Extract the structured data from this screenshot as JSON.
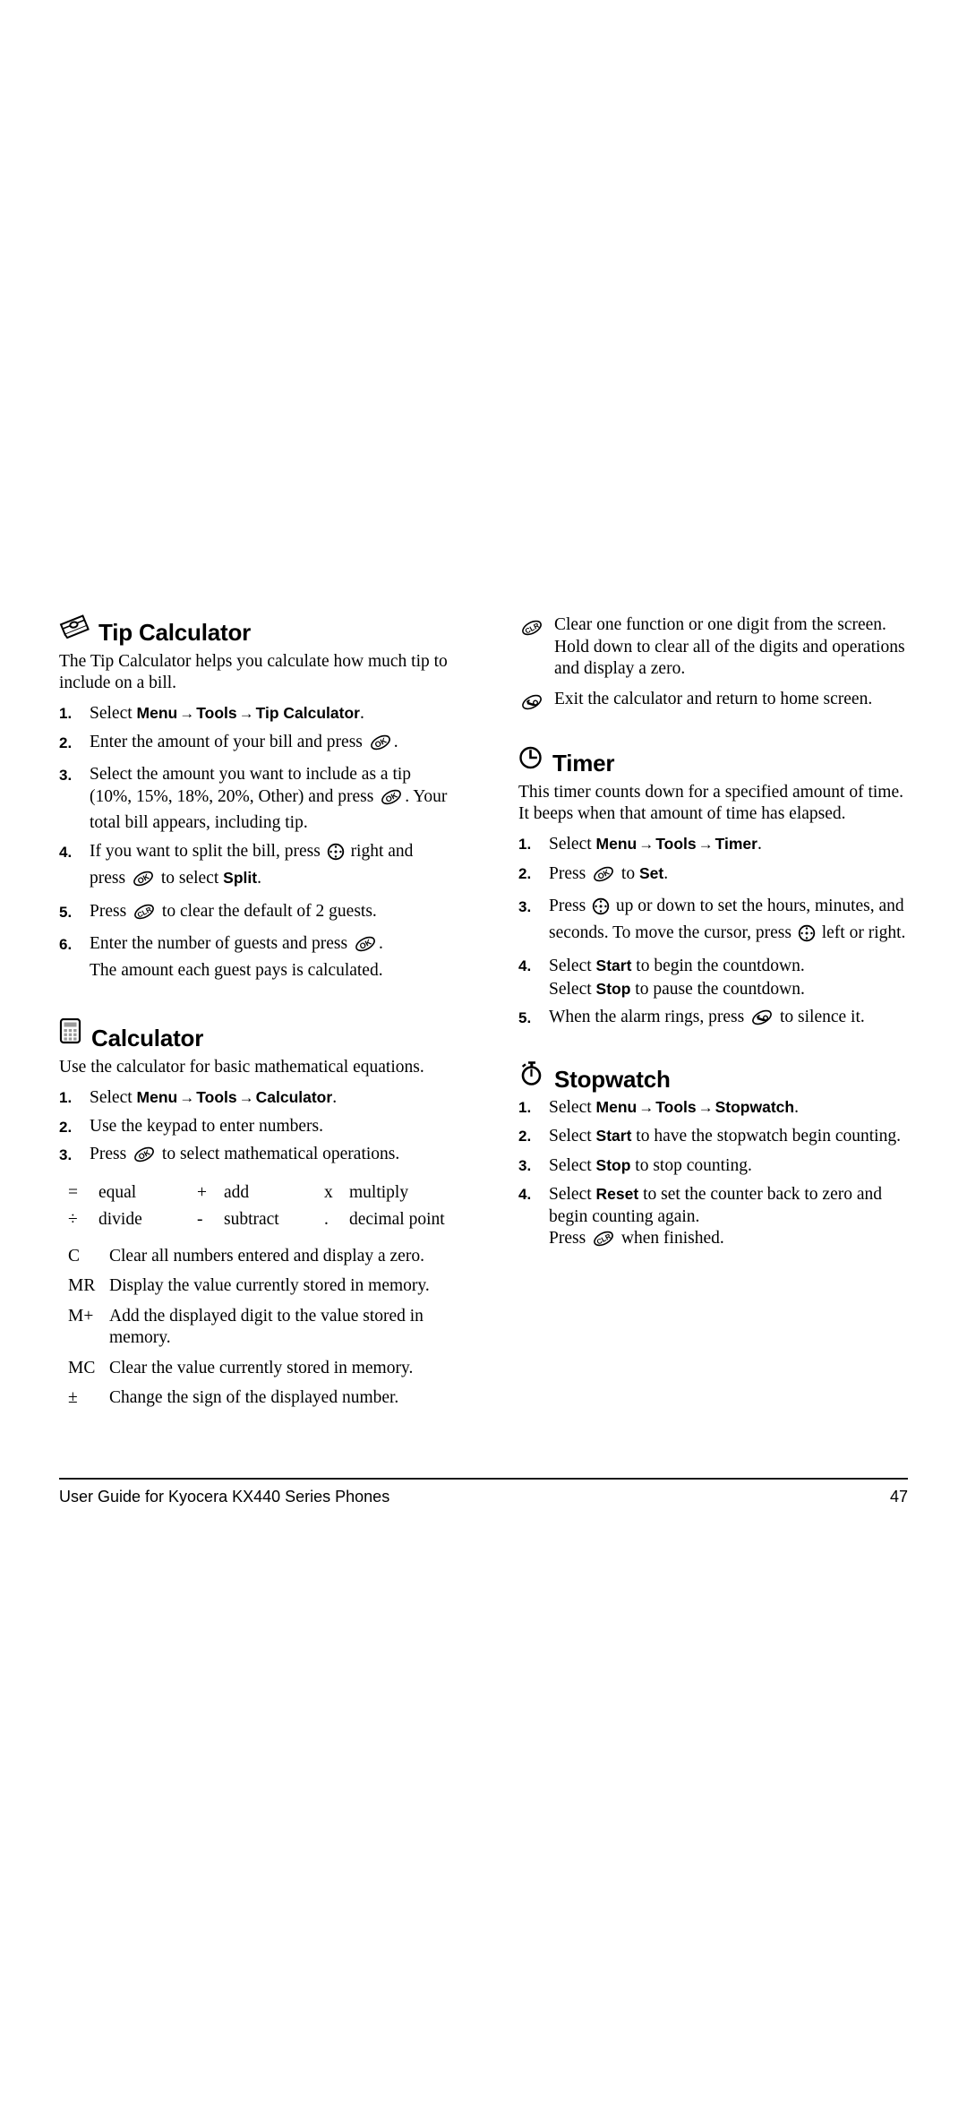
{
  "page": {
    "number": "47",
    "footer_title": "User Guide for Kyocera KX440 Series Phones"
  },
  "icons": {
    "tip_calculator": "money-bills-icon",
    "calculator": "calculator-icon",
    "timer": "clock-icon",
    "stopwatch": "stopwatch-icon",
    "ok_key": "ok-key-icon",
    "clr_key": "clr-key-icon",
    "end_key": "end-call-key-icon",
    "nav_key": "navigation-key-icon"
  },
  "left_column": {
    "tip_calculator": {
      "title": "Tip Calculator",
      "intro": "The Tip Calculator helps you calculate how much tip to include on a bill.",
      "steps": [
        {
          "num": "1.",
          "parts": [
            {
              "t": "text",
              "v": "Select "
            },
            {
              "t": "ui",
              "v": "Menu"
            },
            {
              "t": "arrow",
              "v": "→"
            },
            {
              "t": "ui",
              "v": "Tools"
            },
            {
              "t": "arrow",
              "v": "→"
            },
            {
              "t": "ui",
              "v": "Tip Calculator"
            },
            {
              "t": "text",
              "v": "."
            }
          ]
        },
        {
          "num": "2.",
          "parts": [
            {
              "t": "text",
              "v": "Enter the amount of your bill and press "
            },
            {
              "t": "icon",
              "v": "ok_key"
            },
            {
              "t": "text",
              "v": "."
            }
          ]
        },
        {
          "num": "3.",
          "parts": [
            {
              "t": "text",
              "v": "Select the amount you want to include as a tip (10%, 15%, 18%, 20%, Other) and press "
            },
            {
              "t": "icon",
              "v": "ok_key"
            },
            {
              "t": "text",
              "v": ". Your total bill appears, including tip."
            }
          ]
        },
        {
          "num": "4.",
          "parts": [
            {
              "t": "text",
              "v": "If you want to split the bill, press "
            },
            {
              "t": "icon",
              "v": "nav_key"
            },
            {
              "t": "text",
              "v": " right and press "
            },
            {
              "t": "icon",
              "v": "ok_key"
            },
            {
              "t": "text",
              "v": " to select "
            },
            {
              "t": "ui",
              "v": "Split"
            },
            {
              "t": "text",
              "v": "."
            }
          ]
        },
        {
          "num": "5.",
          "parts": [
            {
              "t": "text",
              "v": "Press "
            },
            {
              "t": "icon",
              "v": "clr_key"
            },
            {
              "t": "text",
              "v": " to clear the default of 2 guests."
            }
          ]
        },
        {
          "num": "6.",
          "parts": [
            {
              "t": "text",
              "v": "Enter the number of guests and press "
            },
            {
              "t": "icon",
              "v": "ok_key"
            },
            {
              "t": "text",
              "v": "."
            }
          ],
          "extra": "The amount each guest pays is calculated."
        }
      ]
    },
    "calculator": {
      "title": "Calculator",
      "intro": "Use the calculator for basic mathematical equations.",
      "steps": [
        {
          "num": "1.",
          "parts": [
            {
              "t": "text",
              "v": "Select "
            },
            {
              "t": "ui",
              "v": "Menu"
            },
            {
              "t": "arrow",
              "v": "→"
            },
            {
              "t": "ui",
              "v": "Tools"
            },
            {
              "t": "arrow",
              "v": "→"
            },
            {
              "t": "ui",
              "v": "Calculator"
            },
            {
              "t": "text",
              "v": "."
            }
          ]
        },
        {
          "num": "2.",
          "parts": [
            {
              "t": "text",
              "v": "Use the keypad to enter numbers."
            }
          ]
        },
        {
          "num": "3.",
          "parts": [
            {
              "t": "text",
              "v": "Press "
            },
            {
              "t": "icon",
              "v": "ok_key"
            },
            {
              "t": "text",
              "v": " to select mathematical operations."
            }
          ]
        }
      ],
      "operations": [
        {
          "sym": "=",
          "word": "equal"
        },
        {
          "sym": "+",
          "word": "add"
        },
        {
          "sym": "x",
          "word": "multiply"
        },
        {
          "sym": "÷",
          "word": "divide"
        },
        {
          "sym": "-",
          "word": "subtract"
        },
        {
          "sym": ".",
          "word": "decimal point"
        }
      ],
      "memory_functions": [
        {
          "key": "C",
          "desc": "Clear all numbers entered and display a zero."
        },
        {
          "key": "MR",
          "desc": "Display the value currently stored in memory."
        },
        {
          "key": "M+",
          "desc": "Add the displayed digit to the value stored in memory."
        },
        {
          "key": "MC",
          "desc": "Clear the value currently stored in memory."
        },
        {
          "key": "±",
          "desc": "Change the sign of the displayed number."
        }
      ]
    }
  },
  "right_column": {
    "key_definitions": [
      {
        "icon": "clr_key",
        "desc": "Clear one function or one digit from the screen. Hold down to clear all of the digits and operations and display a zero."
      },
      {
        "icon": "end_key",
        "desc": "Exit the calculator and return to home screen."
      }
    ],
    "timer": {
      "title": "Timer",
      "intro": "This timer counts down for a specified amount of time. It beeps when that amount of time has elapsed.",
      "steps": [
        {
          "num": "1.",
          "parts": [
            {
              "t": "text",
              "v": "Select "
            },
            {
              "t": "ui",
              "v": "Menu"
            },
            {
              "t": "arrow",
              "v": "→"
            },
            {
              "t": "ui",
              "v": "Tools"
            },
            {
              "t": "arrow",
              "v": "→"
            },
            {
              "t": "ui",
              "v": "Timer"
            },
            {
              "t": "text",
              "v": "."
            }
          ]
        },
        {
          "num": "2.",
          "parts": [
            {
              "t": "text",
              "v": "Press "
            },
            {
              "t": "icon",
              "v": "ok_key"
            },
            {
              "t": "text",
              "v": " to "
            },
            {
              "t": "ui",
              "v": "Set"
            },
            {
              "t": "text",
              "v": "."
            }
          ]
        },
        {
          "num": "3.",
          "parts": [
            {
              "t": "text",
              "v": "Press "
            },
            {
              "t": "icon",
              "v": "nav_key"
            },
            {
              "t": "text",
              "v": " up or down to set the hours, minutes, and seconds. To move the cursor, press "
            },
            {
              "t": "icon",
              "v": "nav_key"
            },
            {
              "t": "text",
              "v": " left or right."
            }
          ]
        },
        {
          "num": "4.",
          "parts": [
            {
              "t": "text",
              "v": "Select "
            },
            {
              "t": "ui",
              "v": "Start"
            },
            {
              "t": "text",
              "v": " to begin the countdown."
            }
          ],
          "extra_parts": [
            {
              "t": "text",
              "v": "Select "
            },
            {
              "t": "ui",
              "v": "Stop"
            },
            {
              "t": "text",
              "v": " to pause the countdown."
            }
          ]
        },
        {
          "num": "5.",
          "parts": [
            {
              "t": "text",
              "v": "When the alarm rings, press "
            },
            {
              "t": "icon",
              "v": "end_key"
            },
            {
              "t": "text",
              "v": " to silence it."
            }
          ]
        }
      ]
    },
    "stopwatch": {
      "title": "Stopwatch",
      "steps": [
        {
          "num": "1.",
          "parts": [
            {
              "t": "text",
              "v": "Select "
            },
            {
              "t": "ui",
              "v": "Menu"
            },
            {
              "t": "arrow",
              "v": "→"
            },
            {
              "t": "ui",
              "v": "Tools"
            },
            {
              "t": "arrow",
              "v": "→"
            },
            {
              "t": "ui",
              "v": "Stopwatch"
            },
            {
              "t": "text",
              "v": "."
            }
          ]
        },
        {
          "num": "2.",
          "parts": [
            {
              "t": "text",
              "v": "Select "
            },
            {
              "t": "ui",
              "v": "Start"
            },
            {
              "t": "text",
              "v": " to have the stopwatch begin counting."
            }
          ]
        },
        {
          "num": "3.",
          "parts": [
            {
              "t": "text",
              "v": "Select "
            },
            {
              "t": "ui",
              "v": "Stop"
            },
            {
              "t": "text",
              "v": " to stop counting."
            }
          ]
        },
        {
          "num": "4.",
          "parts": [
            {
              "t": "text",
              "v": "Select "
            },
            {
              "t": "ui",
              "v": "Reset"
            },
            {
              "t": "text",
              "v": " to set the counter back to zero and begin counting again."
            }
          ],
          "extra_parts": [
            {
              "t": "text",
              "v": "Press "
            },
            {
              "t": "icon",
              "v": "clr_key"
            },
            {
              "t": "text",
              "v": " when finished."
            }
          ]
        }
      ]
    }
  }
}
